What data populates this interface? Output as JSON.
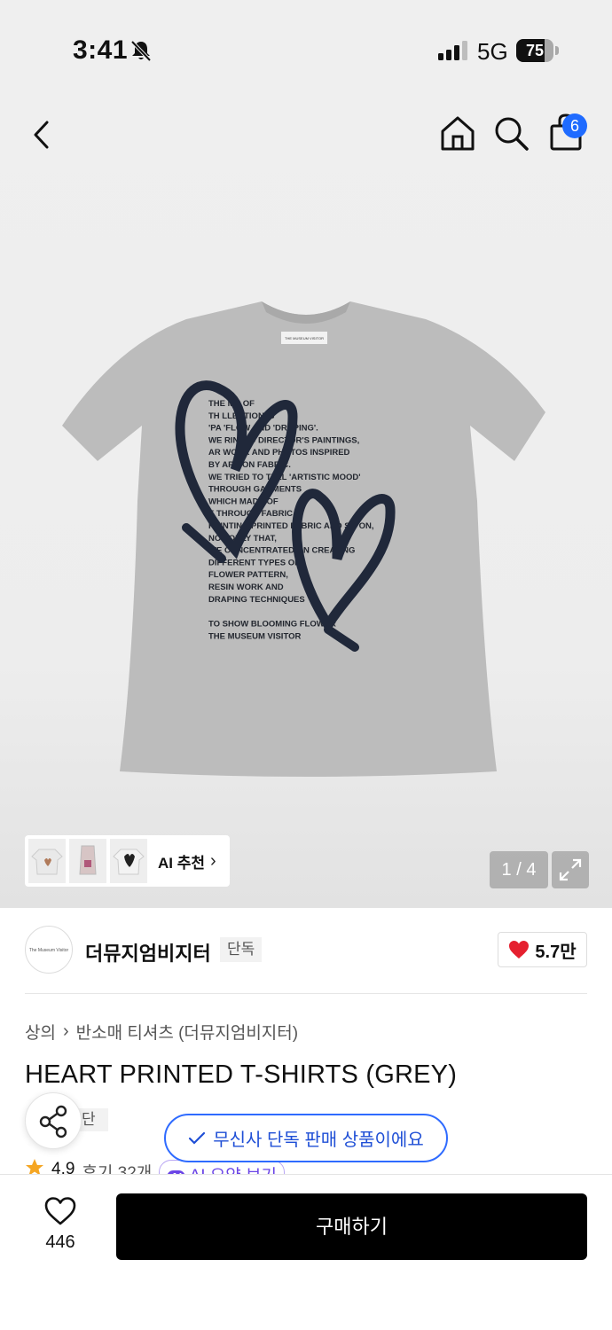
{
  "status_bar": {
    "time": "3:41",
    "network": "5G",
    "battery_percent": "75",
    "battery_level": 0.75,
    "icons": [
      "bell-off-icon",
      "signal-icon",
      "battery-icon"
    ]
  },
  "top_nav": {
    "icons": [
      "back-icon",
      "home-icon",
      "search-icon",
      "cart-icon"
    ],
    "cart_badge": "6"
  },
  "gallery": {
    "ai_recommend_label": "AI 추천",
    "page_indicator": "1 / 4",
    "expand_icon": "expand-icon",
    "shirt_print_text": [
      "THE MA       OF",
      "TH      LLECTION IS",
      "'PA      'FLOW      AND 'DRAPING'.",
      "WE       RINTED   DIRECTOR'S PAINTINGS,",
      "AR       WORK      AND PHOTOS INSPIRED",
      "BY       ARISON FABRIC.",
      "WE TRIED TO TELL 'ARTISTIC MOOD'",
      "THROUGH GARMENTS",
      "WHICH MADE OF",
      "       E THROUGH FABRIC.",
      "PRINTING PRINTED FABRIC AND SO ON,",
      "NOT ONLY THAT,",
      "WE CONCENTRATED ON CREATING",
      "DIFFERENT TYPES OF",
      "FLOWER PATTERN,",
      "RESIN WORK AND",
      "DRAPING TECHNIQUES",
      "TO SHOW BLOOMING FLOWER",
      "THE MUSEUM VISITOR"
    ],
    "neck_label_text": "THE MUSEUM VISITOR"
  },
  "brand": {
    "logo_text": "The Museum Visitor",
    "name": "더뮤지엄비지터",
    "exclusive_tag": "단독",
    "likes": "5.7만"
  },
  "product": {
    "breadcrumb": [
      "상의",
      "반소매 티셔츠 (더뮤지엄비지터)"
    ],
    "title": "HEART PRINTED T-SHIRTS (GREY)",
    "exclusive_partial": "단독",
    "rating": "4.9",
    "reviews": "후기 32개",
    "ai_summary": "AI 요약 보기"
  },
  "toast": {
    "message": "무신사 단독 판매 상품이에요"
  },
  "bottom_bar": {
    "wish_count": "446",
    "buy_label": "구매하기"
  },
  "colors": {
    "accent_blue": "#1f6bff",
    "heart_red": "#e5202f",
    "shirt_grey": "#b9b9b9",
    "print_navy": "#20283a"
  }
}
